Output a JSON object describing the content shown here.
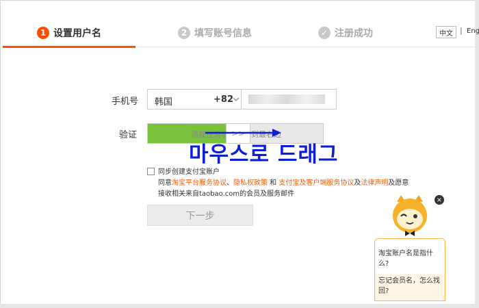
{
  "steps": [
    {
      "num": "1",
      "label": "设置用户名"
    },
    {
      "num": "2",
      "label": "填写账号信息"
    },
    {
      "num": "✓",
      "label": "注册成功"
    }
  ],
  "lang": {
    "zh": "中文",
    "sep": "|",
    "en": "Eng"
  },
  "form": {
    "phone_label": "手机号",
    "country_name": "韩国",
    "country_code": "+82",
    "verify_label": "验证",
    "slider_text": "请按住滑块，拖动到最右边",
    "slider_handle": ">>",
    "slider_progress": 0.45,
    "overlay_text": "마우스로 드래그",
    "agree_line1": "同步创建支付宝账户",
    "agree_line2_a": "同意",
    "agree_link1": "淘宝平台服务协议",
    "agree_sep1": "、",
    "agree_link2": "隐私权政策",
    "agree_and": " 和 ",
    "agree_link3": "支付宝及客户端服务协议",
    "agree_and2": "及",
    "agree_link4": "法律声明",
    "agree_tail": "及愿意",
    "agree_line3": "接收相关来自taobao.com的会员及服务邮件",
    "next_button": "下一步"
  },
  "help": {
    "q1": "淘宝账户名是指什么?",
    "q2": "忘记会员名，怎么找回?",
    "close": "×"
  },
  "colors": {
    "accent": "#ff4a00",
    "slider_fill": "#7ac23c",
    "overlay": "#0d1fd6",
    "help_border": "#ffb443"
  }
}
